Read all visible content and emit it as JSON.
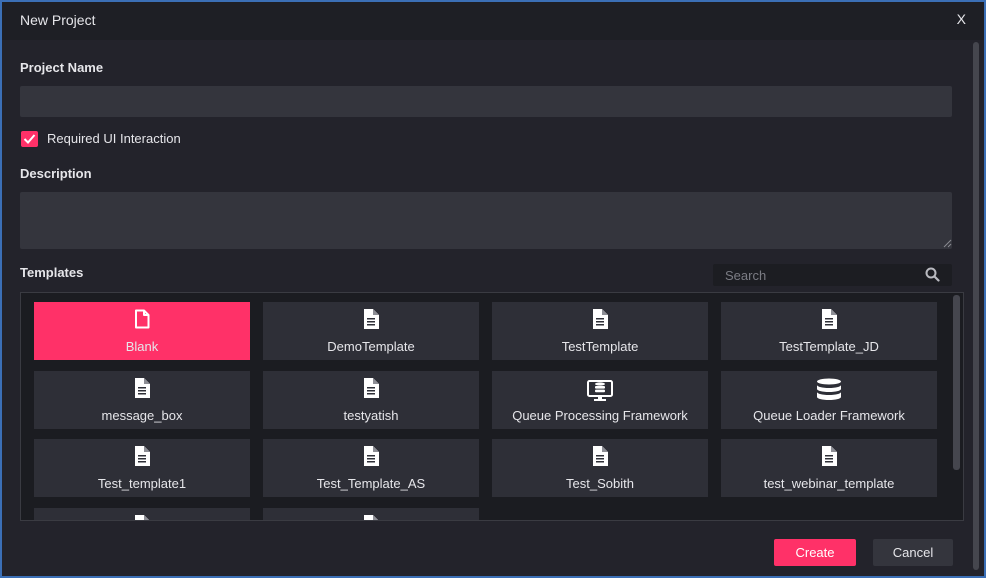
{
  "dialog": {
    "title": "New Project",
    "close_label": "X"
  },
  "form": {
    "project_name_label": "Project Name",
    "project_name_value": "",
    "required_ui_label": "Required UI Interaction",
    "required_ui_checked": true,
    "description_label": "Description",
    "description_value": "",
    "templates_label": "Templates",
    "search_placeholder": "Search"
  },
  "templates": [
    {
      "name": "Blank",
      "icon": "blank-file-icon",
      "selected": true
    },
    {
      "name": "DemoTemplate",
      "icon": "document-icon"
    },
    {
      "name": "TestTemplate",
      "icon": "document-icon"
    },
    {
      "name": "TestTemplate_JD",
      "icon": "document-icon"
    },
    {
      "name": "message_box",
      "icon": "document-icon"
    },
    {
      "name": "testyatish",
      "icon": "document-icon"
    },
    {
      "name": "Queue Processing Framework",
      "icon": "monitor-database-icon"
    },
    {
      "name": "Queue Loader Framework",
      "icon": "database-icon"
    },
    {
      "name": "Test_template1",
      "icon": "document-icon"
    },
    {
      "name": "Test_Template_AS",
      "icon": "document-icon"
    },
    {
      "name": "Test_Sobith",
      "icon": "document-icon"
    },
    {
      "name": "test_webinar_template",
      "icon": "document-icon"
    },
    {
      "name": "",
      "icon": "document-icon"
    },
    {
      "name": "",
      "icon": "document-icon"
    }
  ],
  "actions": {
    "create_label": "Create",
    "cancel_label": "Cancel"
  },
  "colors": {
    "accent": "#ff3168",
    "background": "#23232b",
    "tile": "#2e2f37"
  }
}
